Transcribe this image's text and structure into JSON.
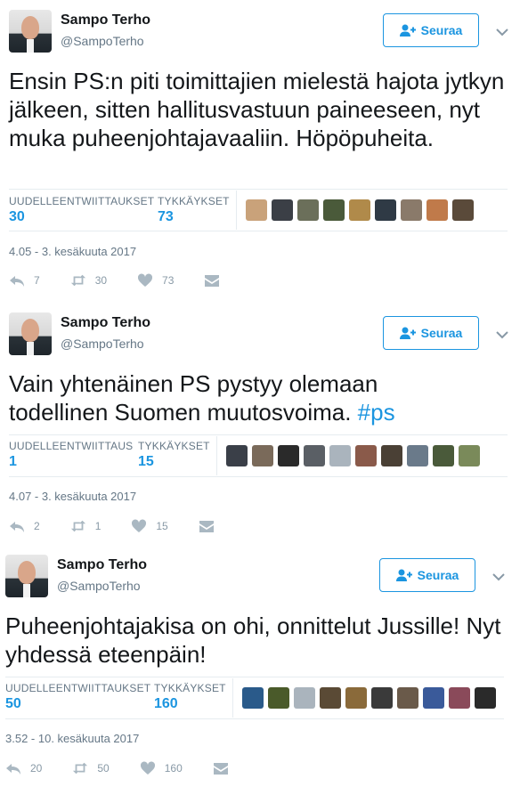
{
  "tweets": [
    {
      "author_name": "Sampo Terho",
      "author_handle": "@SampoTerho",
      "follow_label": "Seuraa",
      "text": "Ensin PS:n piti toimittajien mielestä hajota jytkyn jälkeen, sitten hallitusvastuun paineeseen, nyt muka puheenjohtajavaaliin. Höpöpuheita.",
      "hashtag": "",
      "retweets_label": "UUDELLEENTWIITTAUKSET",
      "retweets_count": "30",
      "likes_label": "TYKKÄYKSET",
      "likes_count": "73",
      "timestamp": "4.05 - 3. kesäkuuta 2017",
      "reply_count": "7",
      "retweet_count": "30",
      "like_count": "73",
      "liker_avatar_colors": [
        "#c9a27a",
        "#3b3f46",
        "#6b6f5a",
        "#4a5a3a",
        "#b08a4a",
        "#2f3a45",
        "#8a7a6a",
        "#c07a4a",
        "#5a4a3a"
      ]
    },
    {
      "author_name": "Sampo Terho",
      "author_handle": "@SampoTerho",
      "follow_label": "Seuraa",
      "text": "Vain yhtenäinen PS pystyy olemaan todellinen Suomen muutosvoima. ",
      "hashtag": "#ps",
      "retweets_label": "UUDELLEENTWIITTAUS",
      "retweets_count": "1",
      "likes_label": "TYKKÄYKSET",
      "likes_count": "15",
      "timestamp": "4.07 - 3. kesäkuuta 2017",
      "reply_count": "2",
      "retweet_count": "1",
      "like_count": "15",
      "liker_avatar_colors": [
        "#3a3f48",
        "#7a6a5a",
        "#2a2a2a",
        "#5a5f65",
        "#aab4bd",
        "#8a5a4a",
        "#4a4035",
        "#6a7a8a",
        "#4a5a3a",
        "#7a8a5a"
      ]
    },
    {
      "author_name": "Sampo Terho",
      "author_handle": "@SampoTerho",
      "follow_label": "Seuraa",
      "text": "Puheenjohtajakisa on ohi, onnittelut Jussille! Nyt yhdessä eteenpäin!",
      "hashtag": "",
      "retweets_label": "UUDELLEENTWIITTAUKSET",
      "retweets_count": "50",
      "likes_label": "TYKKÄYKSET",
      "likes_count": "160",
      "timestamp": "3.52 - 10. kesäkuuta 2017",
      "reply_count": "20",
      "retweet_count": "50",
      "like_count": "160",
      "liker_avatar_colors": [
        "#2a5a8a",
        "#4a5a2a",
        "#aab4bd",
        "#5a4a35",
        "#8a6a3a",
        "#3a3a3a",
        "#6a5a4a",
        "#3a5a9a",
        "#8a4a5a",
        "#2a2a2a"
      ]
    }
  ]
}
